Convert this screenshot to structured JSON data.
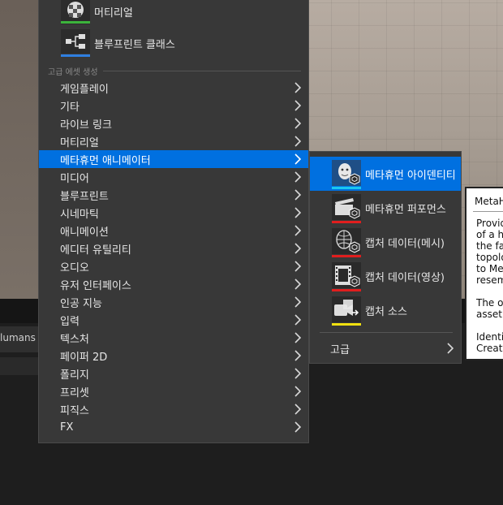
{
  "background_tab": {
    "label": "lumans"
  },
  "main_menu": {
    "top_items": [
      {
        "label": "머티리얼",
        "icon": "material-sphere-icon",
        "bar_color": "#3cb43c"
      },
      {
        "label": "블루프린트 클래스",
        "icon": "blueprint-node-icon",
        "bar_color": "#2f7fe0"
      }
    ],
    "section_header": "고급 에셋 생성",
    "items": [
      {
        "label": "게임플레이"
      },
      {
        "label": "기타"
      },
      {
        "label": "라이브 링크"
      },
      {
        "label": "머티리얼"
      },
      {
        "label": "메타휴먼 애니메이터",
        "active": true
      },
      {
        "label": "미디어"
      },
      {
        "label": "블루프린트"
      },
      {
        "label": "시네마틱"
      },
      {
        "label": "애니메이션"
      },
      {
        "label": "에디터 유틸리티"
      },
      {
        "label": "오디오"
      },
      {
        "label": "유저 인터페이스"
      },
      {
        "label": "인공 지능"
      },
      {
        "label": "입력"
      },
      {
        "label": "텍스처"
      },
      {
        "label": "페이퍼 2D"
      },
      {
        "label": "폴리지"
      },
      {
        "label": "프리셋"
      },
      {
        "label": "피직스"
      },
      {
        "label": "FX"
      }
    ]
  },
  "submenu": {
    "items": [
      {
        "label": "메타휴먼 아이덴티티",
        "icon": "metahuman-identity-icon",
        "bar_color": "#19c6f0",
        "active": true
      },
      {
        "label": "메타휴먼 퍼포먼스",
        "icon": "clapperboard-icon",
        "bar_color": "#e01e1e"
      },
      {
        "label": "캡처 데이터(메시)",
        "icon": "mesh-head-icon",
        "bar_color": "#e01e1e"
      },
      {
        "label": "캡처 데이터(영상)",
        "icon": "film-strip-icon",
        "bar_color": "#e01e1e"
      },
      {
        "label": "캡처 소스",
        "icon": "camera-source-icon",
        "bar_color": "#f0e010"
      }
    ],
    "advanced": {
      "label": "고급"
    }
  },
  "tooltip": {
    "title": "MetaH",
    "body": "Provid\nof a hu\nthe fac\ntopolo\nto Met\nresemb\n\nThe ob\nasset f\n\nIdentit\nCreato"
  },
  "colors": {
    "accent": "#0070e0",
    "menu_bg": "#383838"
  }
}
